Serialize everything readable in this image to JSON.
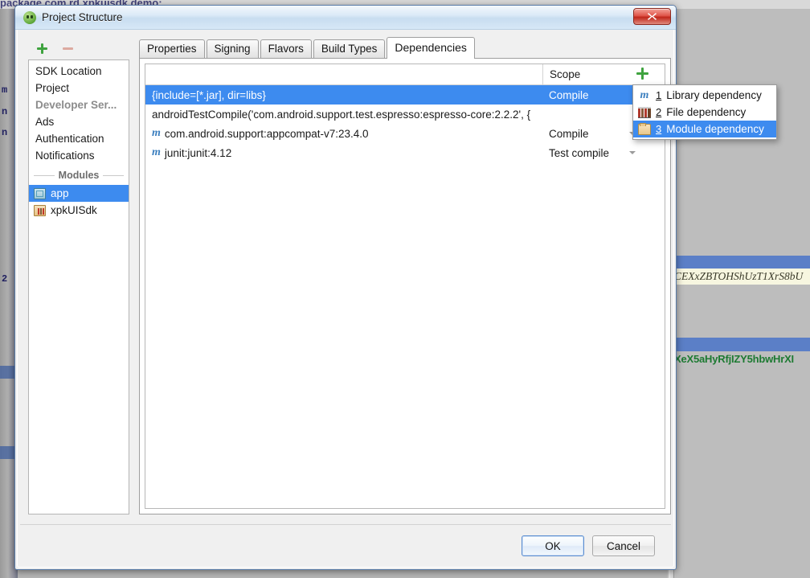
{
  "background": {
    "package_line": "package com.rd.xpkuisdk.demo;",
    "left_code_fragments": [
      "m",
      "n",
      "n",
      "2"
    ],
    "highlighted_code": "CEXxZBTOHShUzT1XrS8bU",
    "green_code": "XeX5aHyRfjIZY5hbwHrXI",
    "colors": {
      "selection_blue": "#5b7fc7",
      "highlight_yellow": "#f7f6e0",
      "green_text": "#1d7a32"
    }
  },
  "dialog": {
    "title": "Project Structure",
    "icon": "android-studio-icon",
    "close_label": "Close",
    "sidebar": {
      "toolbar": {
        "add_label": "+",
        "remove_label": "−"
      },
      "items": [
        {
          "label": "SDK Location",
          "state": "normal"
        },
        {
          "label": "Project",
          "state": "normal"
        },
        {
          "label": "Developer Ser...",
          "state": "disabled"
        },
        {
          "label": "Ads",
          "state": "normal"
        },
        {
          "label": "Authentication",
          "state": "normal"
        },
        {
          "label": "Notifications",
          "state": "normal"
        }
      ],
      "group_label": "Modules",
      "modules": [
        {
          "label": "app",
          "icon": "module-icon",
          "selected": true
        },
        {
          "label": "xpkUISdk",
          "icon": "library-module-icon",
          "selected": false
        }
      ]
    },
    "tabs": [
      {
        "label": "Properties",
        "active": false
      },
      {
        "label": "Signing",
        "active": false
      },
      {
        "label": "Flavors",
        "active": false
      },
      {
        "label": "Build Types",
        "active": false
      },
      {
        "label": "Dependencies",
        "active": true
      }
    ],
    "dependencies_table": {
      "columns": {
        "name": "",
        "scope": "Scope"
      },
      "add_button_label": "+",
      "rows": [
        {
          "name": "{include=[*.jar], dir=libs}",
          "scope": "Compile",
          "icon": null,
          "selected": true,
          "has_scope_caret": false
        },
        {
          "name": "androidTestCompile('com.android.support.test.espresso:espresso-core:2.2.2', {",
          "scope": "",
          "icon": null,
          "selected": false,
          "has_scope_caret": false
        },
        {
          "name": "com.android.support:appcompat-v7:23.4.0",
          "scope": "Compile",
          "icon": "maven-m-icon",
          "selected": false,
          "has_scope_caret": true
        },
        {
          "name": "junit:junit:4.12",
          "scope": "Test compile",
          "icon": "maven-m-icon",
          "selected": false,
          "has_scope_caret": true
        }
      ]
    },
    "add_menu": {
      "items": [
        {
          "num": "1",
          "label": "Library dependency",
          "icon": "maven-m-icon",
          "selected": false
        },
        {
          "num": "2",
          "label": "File dependency",
          "icon": "books-icon",
          "selected": false
        },
        {
          "num": "3",
          "label": "Module dependency",
          "icon": "folder-icon",
          "selected": true
        }
      ]
    },
    "footer": {
      "ok_label": "OK",
      "cancel_label": "Cancel"
    }
  }
}
